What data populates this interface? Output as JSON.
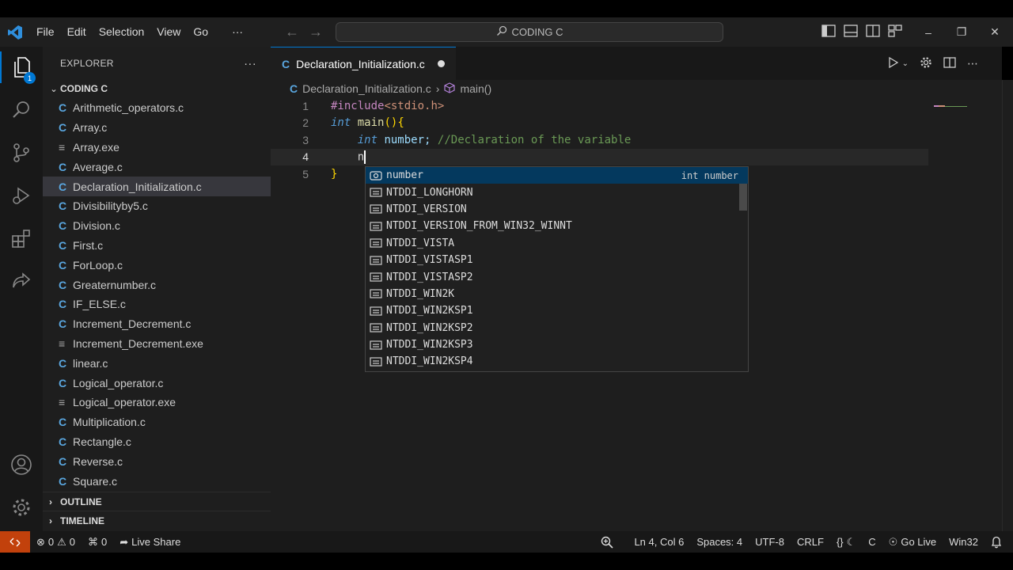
{
  "titlebar": {
    "menu": [
      "File",
      "Edit",
      "Selection",
      "View",
      "Go",
      "···"
    ],
    "search_label": "CODING C"
  },
  "activity": {
    "explorer_badge": "1"
  },
  "sidebar": {
    "header": "EXPLORER",
    "more": "···",
    "folder": "CODING C",
    "files": [
      {
        "name": "Arithmetic_operators.c",
        "kind": "c"
      },
      {
        "name": "Array.c",
        "kind": "c"
      },
      {
        "name": "Array.exe",
        "kind": "exe"
      },
      {
        "name": "Average.c",
        "kind": "c"
      },
      {
        "name": "Declaration_Initialization.c",
        "kind": "c"
      },
      {
        "name": "Divisibilityby5.c",
        "kind": "c"
      },
      {
        "name": "Division.c",
        "kind": "c"
      },
      {
        "name": "First.c",
        "kind": "c"
      },
      {
        "name": "ForLoop.c",
        "kind": "c"
      },
      {
        "name": "Greaternumber.c",
        "kind": "c"
      },
      {
        "name": "IF_ELSE.c",
        "kind": "c"
      },
      {
        "name": "Increment_Decrement.c",
        "kind": "c"
      },
      {
        "name": "Increment_Decrement.exe",
        "kind": "exe"
      },
      {
        "name": "linear.c",
        "kind": "c"
      },
      {
        "name": "Logical_operator.c",
        "kind": "c"
      },
      {
        "name": "Logical_operator.exe",
        "kind": "exe"
      },
      {
        "name": "Multiplication.c",
        "kind": "c"
      },
      {
        "name": "Rectangle.c",
        "kind": "c"
      },
      {
        "name": "Reverse.c",
        "kind": "c"
      },
      {
        "name": "Square.c",
        "kind": "c"
      }
    ],
    "selected_file": "Declaration_Initialization.c",
    "outline": "OUTLINE",
    "timeline": "TIMELINE"
  },
  "editor": {
    "tab_label": "Declaration_Initialization.c",
    "file_icon": "C",
    "breadcrumb_file": "Declaration_Initialization.c",
    "breadcrumb_symbol": "main()",
    "line_numbers": [
      "1",
      "2",
      "3",
      "4",
      "5"
    ],
    "code": {
      "l1_directive": "#include",
      "l1_header": "<stdio.h>",
      "l2_type": "int",
      "l2_fn": "main",
      "l2_parens": "()",
      "l2_brace": "{",
      "l3_type": "int",
      "l3_var": "number;",
      "l3_comment": "//Declaration of the variable",
      "l4_typed": "n",
      "l5_brace": "}"
    }
  },
  "suggest": {
    "items": [
      {
        "label": "number",
        "kind": "variable",
        "detail": "int number"
      },
      {
        "label": "NTDDI_LONGHORN",
        "kind": "constant"
      },
      {
        "label": "NTDDI_VERSION",
        "kind": "constant"
      },
      {
        "label": "NTDDI_VERSION_FROM_WIN32_WINNT",
        "kind": "constant"
      },
      {
        "label": "NTDDI_VISTA",
        "kind": "constant"
      },
      {
        "label": "NTDDI_VISTASP1",
        "kind": "constant"
      },
      {
        "label": "NTDDI_VISTASP2",
        "kind": "constant"
      },
      {
        "label": "NTDDI_WIN2K",
        "kind": "constant"
      },
      {
        "label": "NTDDI_WIN2KSP1",
        "kind": "constant"
      },
      {
        "label": "NTDDI_WIN2KSP2",
        "kind": "constant"
      },
      {
        "label": "NTDDI_WIN2KSP3",
        "kind": "constant"
      },
      {
        "label": "NTDDI_WIN2KSP4",
        "kind": "constant"
      }
    ]
  },
  "statusbar": {
    "errors": "0",
    "warnings": "0",
    "ports": "0",
    "live_share": "Live Share",
    "position": "Ln 4, Col 6",
    "spaces": "Spaces: 4",
    "encoding": "UTF-8",
    "eol": "CRLF",
    "brackets": "{}",
    "language": "C",
    "go_live": "Go Live",
    "platform": "Win32"
  },
  "colors": {
    "accent": "#0078d4",
    "remote": "#c2410c",
    "c_icon": "#5aa7e0"
  }
}
